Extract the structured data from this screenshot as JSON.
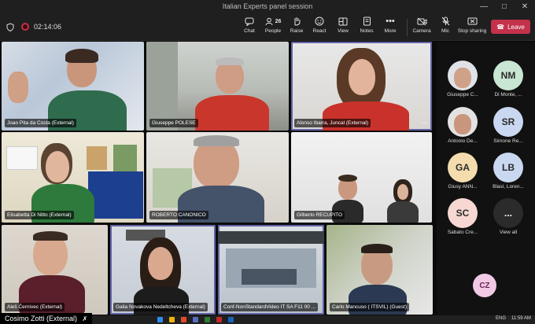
{
  "window": {
    "title": "Italian Experts panel session"
  },
  "toolbar": {
    "timer": "02:14:06",
    "buttons": [
      {
        "label": "Chat",
        "icon": "chat-icon"
      },
      {
        "label": "People",
        "icon": "people-icon",
        "count": "26"
      },
      {
        "label": "Raise",
        "icon": "raise-hand-icon"
      },
      {
        "label": "React",
        "icon": "react-icon"
      },
      {
        "label": "View",
        "icon": "view-icon"
      },
      {
        "label": "Notes",
        "icon": "notes-icon"
      },
      {
        "label": "More",
        "icon": "more-icon"
      },
      {
        "label": "Camera",
        "icon": "camera-off-icon"
      },
      {
        "label": "Mic",
        "icon": "mic-off-icon"
      },
      {
        "label": "Stop sharing",
        "icon": "stop-sharing-icon"
      }
    ],
    "leave_label": "Leave"
  },
  "participants": [
    {
      "name": "Joao Pita da Costa (External)"
    },
    {
      "name": "Giuseppe POLESE"
    },
    {
      "name": "Alonso Ibarra, Juncal (External)"
    },
    {
      "name": "Elisabetta Di Nitto (External)"
    },
    {
      "name": "ROBERTO CANONICO"
    },
    {
      "name": "Gilberto RECUPITO"
    },
    {
      "name": "Aleš Černivec (External)"
    },
    {
      "name": "Galia Novakova Nedeltcheva (External)"
    },
    {
      "name": "Conf-NonStandardVideo IT SA F11 00 ..."
    },
    {
      "name": "Carlo Mancuso ( ITSVIL) (Guest)"
    }
  ],
  "sidebar": {
    "people": [
      {
        "name": "Giuseppe C...",
        "initials": ""
      },
      {
        "name": "Di Monte, ...",
        "initials": "NM"
      },
      {
        "name": "Antonio De...",
        "initials": ""
      },
      {
        "name": "Simone Re...",
        "initials": "SR"
      },
      {
        "name": "Giusy ANN...",
        "initials": "GA"
      },
      {
        "name": "Blasi, Loren...",
        "initials": "LB"
      },
      {
        "name": "Sabato Cre...",
        "initials": "SC"
      },
      {
        "name": "View all",
        "initials": "..."
      }
    ],
    "self_initials": "CZ"
  },
  "active_speaker": "Cosimo Zotti (External)",
  "taskbar": {
    "lang": "ENG",
    "time": "11:59 AM"
  }
}
